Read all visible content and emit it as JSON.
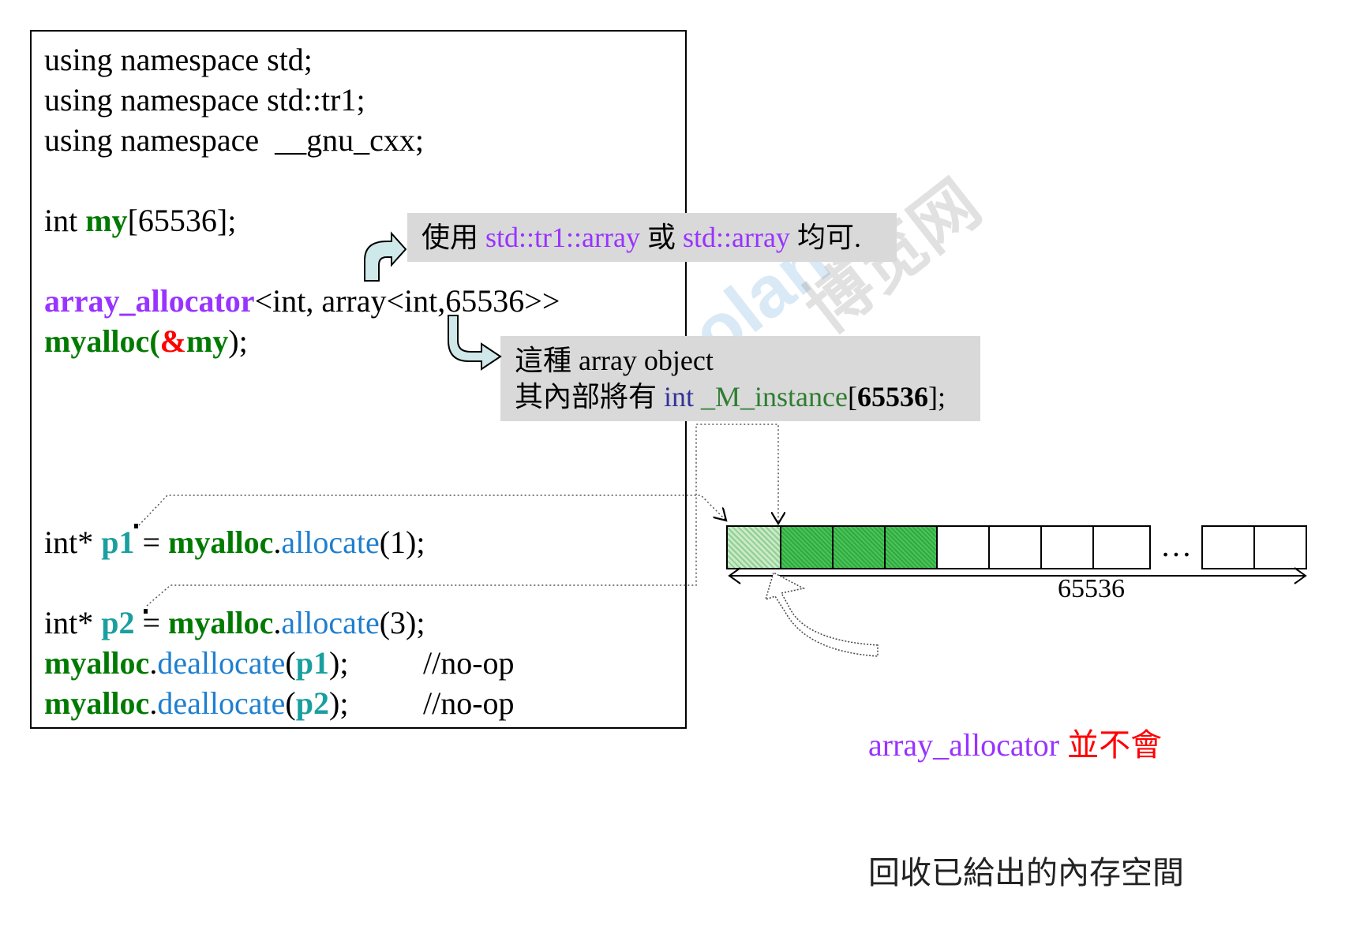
{
  "code": {
    "l1": "using namespace std;",
    "l2": "using namespace std::tr1;",
    "l3": "using namespace  __gnu_cxx;",
    "l4_kw": "int ",
    "l4_name": "my",
    "l4_rest": "[65536];",
    "l5_name": "array_allocator",
    "l5_rest": "<int, array<int,65536>>",
    "l6_name": "myalloc",
    "l6_open": "(",
    "l6_amp": "&",
    "l6_my": "my",
    "l6_close": ");",
    "l7_pre": "int* ",
    "l7_var": "p1",
    "l7_eq": " = ",
    "l7_obj": "myalloc",
    "l7_dot": ".",
    "l7_fn": "allocate",
    "l7_args": "(1);",
    "l8_pre": "int* ",
    "l8_var": "p2",
    "l8_eq": " = ",
    "l8_obj": "myalloc",
    "l8_dot": ".",
    "l8_fn": "allocate",
    "l8_args": "(3);",
    "l9_obj": "myalloc",
    "l9_dot": ".",
    "l9_fn": "deallocate",
    "l9_open": "(",
    "l9_arg": "p1",
    "l9_close": ");",
    "l9_comment": "//no-op",
    "l10_obj": "myalloc",
    "l10_dot": ".",
    "l10_fn": "deallocate",
    "l10_open": "(",
    "l10_arg": "p2",
    "l10_close": ");",
    "l10_comment": "//no-op"
  },
  "note1": {
    "pre": "使用 ",
    "opt1": "std::tr1::array",
    "mid": " 或 ",
    "opt2": "std::array",
    "post": " 均可."
  },
  "note2": {
    "line1": "這種 array object",
    "line2_pre": "其內部將有 ",
    "line2_type": "int",
    "line2_space": " ",
    "line2_name": "_M_instance",
    "line2_open": "[",
    "line2_size": "65536",
    "line2_close": "];"
  },
  "memory": {
    "size_label": "65536",
    "ellipsis": "…"
  },
  "note3": {
    "name": "array_allocator",
    "space": " ",
    "neg": "並不會",
    "line2": "回收已給出的內存空間"
  },
  "watermark": {
    "brand": "Boolan",
    "cn": "博览网"
  },
  "colors": {
    "green": "#007a00",
    "purple": "#9933ff",
    "red": "#ff0000",
    "blue": "#1f7fcf",
    "teal": "#1a9fa0",
    "note_bg": "#d9d9d9",
    "arrow_fill": "#cfe8ea"
  }
}
